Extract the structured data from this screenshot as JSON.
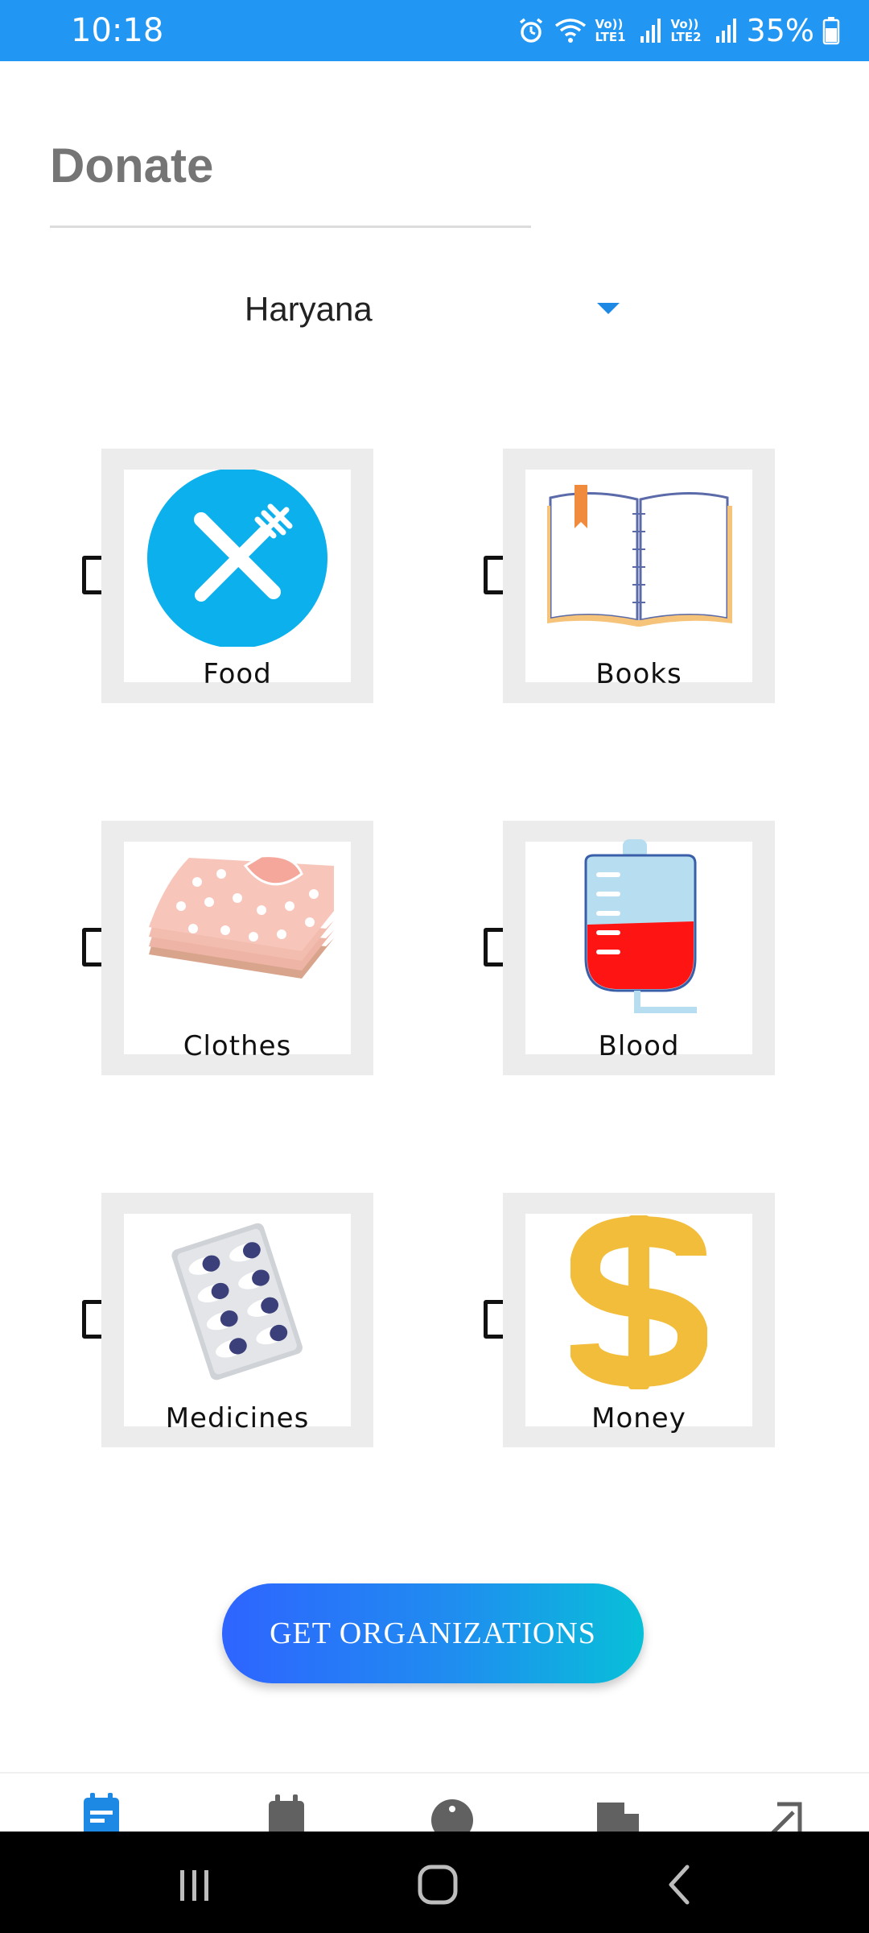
{
  "status_bar": {
    "time": "10:18",
    "lte1": "Vo)) LTE1",
    "lte2": "Vo)) LTE2",
    "battery": "35%"
  },
  "header": {
    "title": "Donate"
  },
  "state_selector": {
    "selected": "Haryana"
  },
  "categories": [
    {
      "label": "Food",
      "icon": "food-icon",
      "checked": false
    },
    {
      "label": "Books",
      "icon": "book-icon",
      "checked": false
    },
    {
      "label": "Clothes",
      "icon": "clothes-icon",
      "checked": false
    },
    {
      "label": "Blood",
      "icon": "blood-bag-icon",
      "checked": false
    },
    {
      "label": "Medicines",
      "icon": "pills-icon",
      "checked": false
    },
    {
      "label": "Money",
      "icon": "dollar-icon",
      "checked": false
    }
  ],
  "actions": {
    "get_organizations": "GET ORGANIZATIONS"
  },
  "bottom_nav": {
    "items": [
      "donate-tab-icon",
      "calendar-tab-icon",
      "info-tab-icon",
      "building-tab-icon",
      "logout-tab-icon"
    ]
  },
  "colors": {
    "status_bar": "#2196F3",
    "accent": "#2196F3",
    "title": "#757575",
    "button_start": "#2e64ff",
    "button_end": "#08c0d8",
    "tile_border": "#ececec"
  }
}
